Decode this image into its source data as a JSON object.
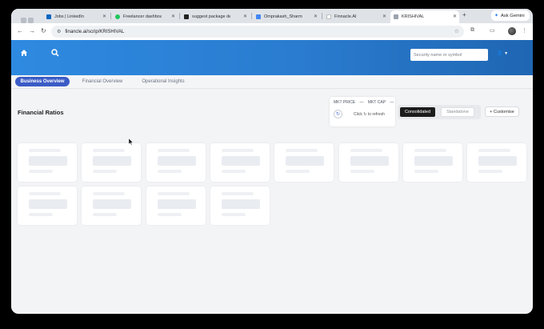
{
  "browser": {
    "tabs": [
      {
        "label": "Jobs | LinkedIn",
        "favicon_color": "#0a66c2"
      },
      {
        "label": "Freelancer dashboard",
        "favicon_color": "#22c55e"
      },
      {
        "label": "suggest package dev",
        "favicon_color": "#222222"
      },
      {
        "label": "Omprakash_Sharma_",
        "favicon_color": "#4285f4"
      },
      {
        "label": "Finnacle.AI",
        "favicon_color": "#e5e7eb"
      },
      {
        "label": "KRISHIVAL",
        "favicon_color": "#9ca3af"
      }
    ],
    "active_tab": 5,
    "ask_gemini": "Ask Gemini",
    "url": "financle.ai/scrip/KRISHIVAL"
  },
  "app": {
    "search_placeholder": "Security name or symbol",
    "header_color": "#2a7cd0"
  },
  "subnav": {
    "tabs": [
      "Business Overview",
      "Financial Overview",
      "Operational Insights"
    ],
    "active": 0
  },
  "ratios": {
    "title": "Financial Ratios",
    "mkt_price_label": "MKT PRICE",
    "mkt_price_value": "—",
    "mkt_cap_label": "MKT CAP",
    "mkt_cap_value": "—",
    "refresh_label": "Click ↻ to refresh",
    "view_options": [
      "Consolidated",
      "Standalone"
    ],
    "selected_view": "Consolidated",
    "customise_label": "+ Customise",
    "loading_card_count": 12
  }
}
